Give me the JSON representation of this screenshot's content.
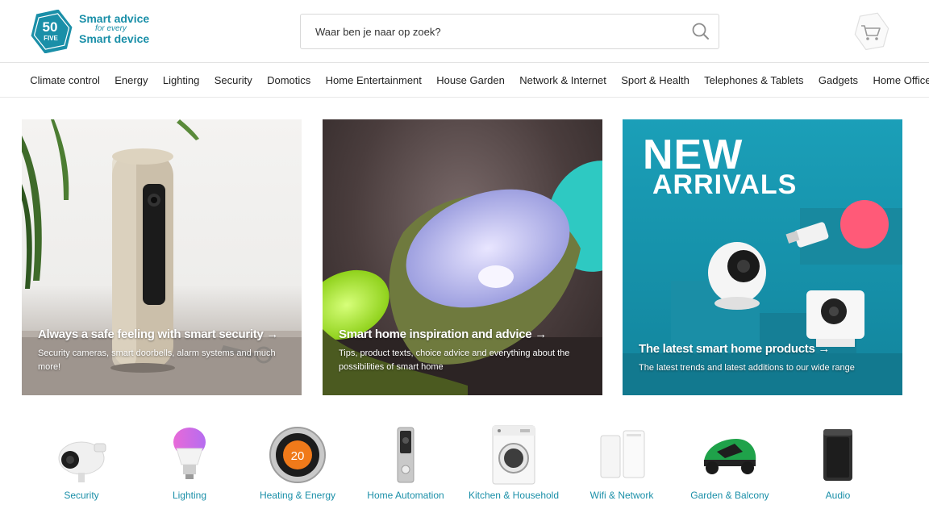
{
  "logo": {
    "badge_number": "50",
    "badge_word": "FIVE",
    "line1": "Smart advice",
    "line2": "for every",
    "line3": "Smart device",
    "brand_color": "#1a8fa8"
  },
  "search": {
    "placeholder": "Waar ben je naar op zoek?",
    "icon": "search-icon"
  },
  "cart": {
    "icon": "cart-icon"
  },
  "nav": {
    "items": [
      "Climate control",
      "Energy",
      "Lighting",
      "Security",
      "Domotics",
      "Home Entertainment",
      "House Garden",
      "Network & Internet",
      "Sport & Health",
      "Telephones & Tablets",
      "Gadgets",
      "Home Office"
    ]
  },
  "banners": [
    {
      "title": "Always a safe feeling with smart security →",
      "subtitle": "Security cameras, smart doorbells, alarm systems and much more!"
    },
    {
      "title": "Smart home inspiration and advice →",
      "subtitle": "Tips, product texts, choice advice and everything about the possibilities of smart home"
    },
    {
      "headline_1": "NEW",
      "headline_2": "ARRIVALS",
      "title": "The latest smart home products →",
      "subtitle": "The latest trends and latest additions to our wide range"
    }
  ],
  "categories": [
    {
      "label": "Security",
      "icon": "security-camera-icon"
    },
    {
      "label": "Lighting",
      "icon": "light-bulb-icon"
    },
    {
      "label": "Heating & Energy",
      "icon": "thermostat-icon",
      "thermostat_value": "20"
    },
    {
      "label": "Home Automation",
      "icon": "video-doorbell-icon"
    },
    {
      "label": "Kitchen & Household",
      "icon": "washing-machine-icon"
    },
    {
      "label": "Wifi & Network",
      "icon": "router-icon"
    },
    {
      "label": "Garden & Balcony",
      "icon": "robot-mower-icon"
    },
    {
      "label": "Audio",
      "icon": "speaker-icon"
    }
  ]
}
